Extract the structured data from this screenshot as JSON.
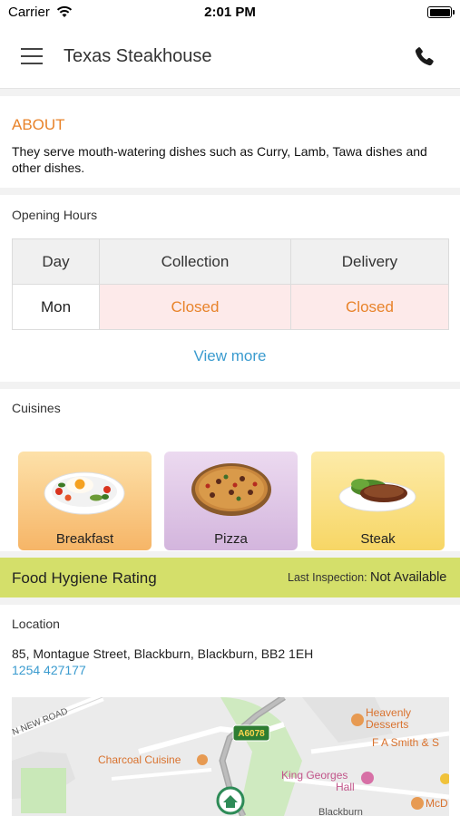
{
  "status_bar": {
    "carrier": "Carrier",
    "time": "2:01 PM"
  },
  "nav": {
    "title": "Texas Steakhouse"
  },
  "about": {
    "title": "ABOUT",
    "text": "They serve mouth-watering dishes such as Curry, Lamb, Tawa dishes  and other dishes."
  },
  "opening_hours": {
    "label": "Opening Hours",
    "headers": [
      "Day",
      "Collection",
      "Delivery"
    ],
    "rows": [
      {
        "day": "Mon",
        "collection": "Closed",
        "delivery": "Closed"
      }
    ],
    "view_more": "View more"
  },
  "cuisines": {
    "label": "Cuisines",
    "items": [
      {
        "label": "Breakfast",
        "color": "#f8c37a"
      },
      {
        "label": "Pizza",
        "color": "#dec6e4"
      },
      {
        "label": "Steak",
        "color": "#fbe48a"
      }
    ]
  },
  "hygiene": {
    "title": "Food Hygiene Rating",
    "last_inspection_label": "Last Inspection:",
    "last_inspection_value": "Not Available",
    "color": "#d4df6a"
  },
  "location": {
    "label": "Location",
    "address": "85, Montague Street, Blackburn, Blackburn, BB2 1EH",
    "phone": "1254 427177"
  },
  "map": {
    "labels": {
      "road": "N NEW ROAD",
      "route": "A6078",
      "charcoal": "Charcoal Cuisine",
      "heavenly_1": "Heavenly",
      "heavenly_2": "Desserts",
      "smith": "F A Smith & S",
      "kg_1": "King Georges",
      "kg_2": "Hall",
      "blackburn": "Blackburn",
      "mcd": "McD"
    }
  },
  "colors": {
    "accent_orange": "#e8832a",
    "link_blue": "#3a9bcf"
  }
}
